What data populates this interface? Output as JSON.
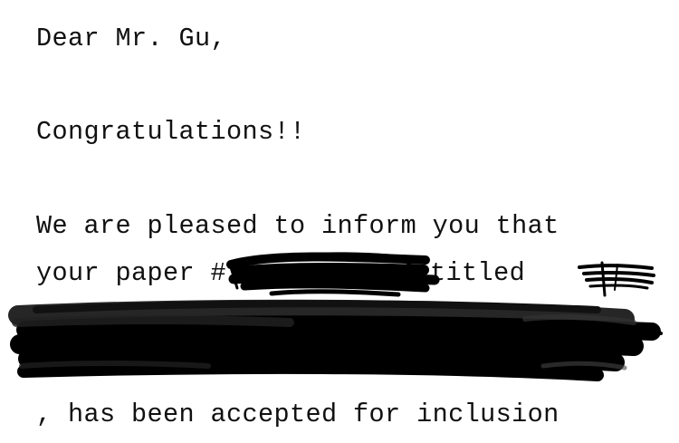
{
  "letter": {
    "salutation": "Dear Mr. Gu,",
    "exclamation": "Congratulations!!",
    "line_inform": "We are pleased to inform you that",
    "line_paper_prefix": "your paper #",
    "line_paper_mid": ", titled ",
    "line_accepted": ", has been accepted for inclusion"
  },
  "redaction": {
    "color": "#000000"
  }
}
